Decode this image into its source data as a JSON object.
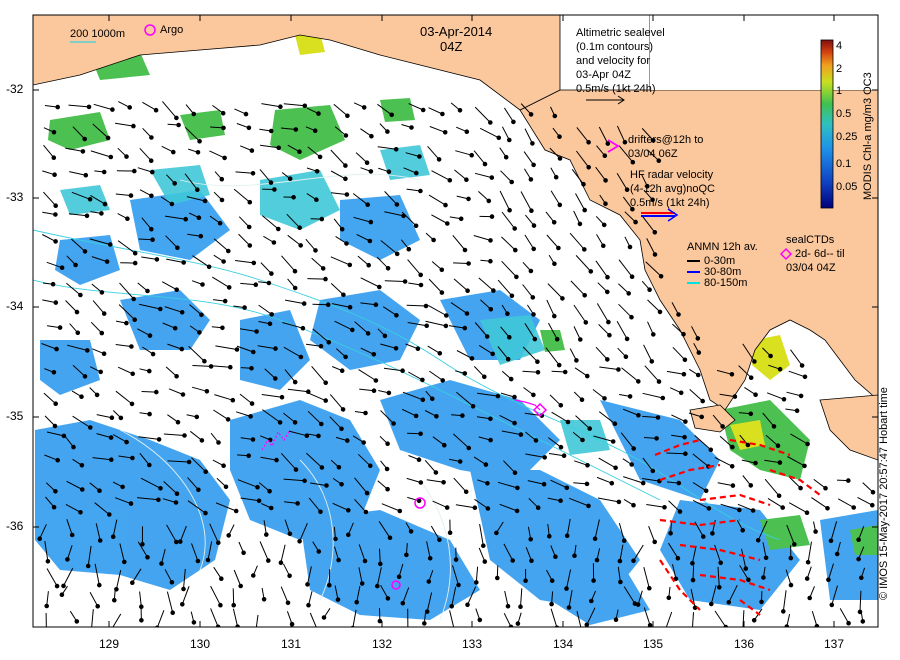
{
  "header": {
    "date": "03-Apr-2014",
    "time": "04Z"
  },
  "legend": {
    "bathymetry": "200 1000m",
    "argo": "Argo",
    "altimetry": [
      "Altimetric sealevel",
      "(0.1m contours)",
      "and velocity for",
      "03-Apr 04Z",
      "0.5m/s (1kt 24h)"
    ],
    "drifters": [
      "drifters@12h to",
      "03/04 06Z"
    ],
    "hf_radar": [
      "HF radar velocity",
      "(4-12h avg)noQC",
      "0.5m/s (1kt 24h)"
    ],
    "anmn_title": "ANMN 12h av.",
    "anmn_items": [
      {
        "label": "0-30m",
        "color": "#000000"
      },
      {
        "label": "30-80m",
        "color": "#0000ff"
      },
      {
        "label": "80-150m",
        "color": "#00e0e0"
      }
    ],
    "sealctds": [
      "sealCTDs",
      "2d- 6d-- til",
      "03/04 04Z"
    ]
  },
  "colorbar": {
    "title": "MODIS Chl-a mg/m3 OC3",
    "ticks": [
      "4",
      "2",
      "1",
      "0.5",
      "0.25",
      "0.1",
      "0.05"
    ]
  },
  "axes": {
    "x_ticks": [
      "129",
      "130",
      "131",
      "132",
      "133",
      "134",
      "135",
      "136",
      "137"
    ],
    "y_ticks": [
      "-32",
      "-33",
      "-34",
      "-35",
      "-36"
    ]
  },
  "credit": "© IMOS 15-May-2017 20:57:47 Hobart time",
  "colors": {
    "land": "#fbc79c",
    "chl_blue": "#3aa0f0",
    "chl_cyan": "#40c8d8",
    "chl_green": "#4cc050",
    "chl_yellow": "#d8e020",
    "drifter": "#ff00ff",
    "seal": "#ff0000",
    "hf": "#0000ff"
  }
}
